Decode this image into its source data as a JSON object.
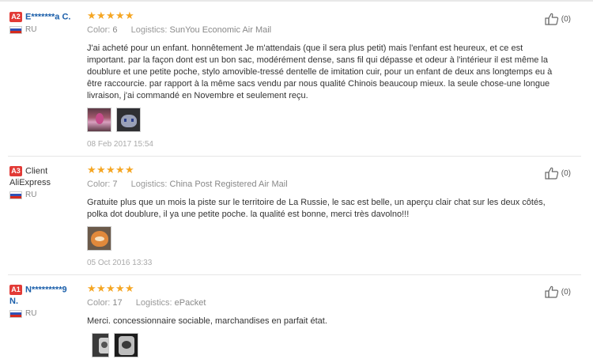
{
  "reviews": [
    {
      "level": "A2",
      "name_line1": "E*******a C.",
      "name_line2": "",
      "country": "RU",
      "stars": 5,
      "color_label": "Color:",
      "color_value": "6",
      "logistics_label": "Logistics:",
      "logistics_value": "SunYou Economic Air Mail",
      "text": "J'ai acheté pour un enfant. honnêtement Je m'attendais (que il sera plus petit) mais l'enfant est heureux, et ce est important. par la façon dont est un bon sac, modérément dense, sans fil qui dépasse et odeur à l'intérieur il est même la doublure et une petite poche, stylo amovible-tressé dentelle de imitation cuir, pour un enfant de deux ans longtemps eu à être raccourcie. par rapport à la même sacs vendu par nous qualité Chinois beaucoup mieux. la seule chose-une longue livraison, j'ai commandé en Novembre et seulement reçu.",
      "photos": [
        "doll-photo",
        "cat-print-photo"
      ],
      "date": "08 Feb 2017 15:54",
      "helpful_count": "(0)"
    },
    {
      "level": "A3",
      "name_line1": "Client",
      "name_line2": "AliExpress",
      "country": "RU",
      "stars": 5,
      "color_label": "Color:",
      "color_value": "7",
      "logistics_label": "Logistics:",
      "logistics_value": "China Post Registered Air Mail",
      "text": "Gratuite plus que un mois la piste sur le territoire de La Russie, le sac est belle, un aperçu clair chat sur les deux côtés, polka dot doublure, il ya une petite poche. la qualité est bonne, merci très davolno!!!",
      "photos": [
        "orange-cat-bag-photo"
      ],
      "date": "05 Oct 2016 13:33",
      "helpful_count": "(0)"
    },
    {
      "level": "A1",
      "name_line1": "N*********9",
      "name_line2": "N.",
      "country": "RU",
      "stars": 5,
      "color_label": "Color:",
      "color_value": "17",
      "logistics_label": "Logistics:",
      "logistics_value": "ePacket",
      "text": "Merci. concessionnaire sociable, marchandises en parfait état.",
      "photos": [
        "bag-front-photo",
        "bag-print-photo"
      ],
      "date": "",
      "helpful_count": "(0)"
    }
  ],
  "colors": {
    "level_badge": "#e23a36",
    "username": "#1b5faa",
    "star": "#f5a623",
    "muted": "#888888"
  }
}
